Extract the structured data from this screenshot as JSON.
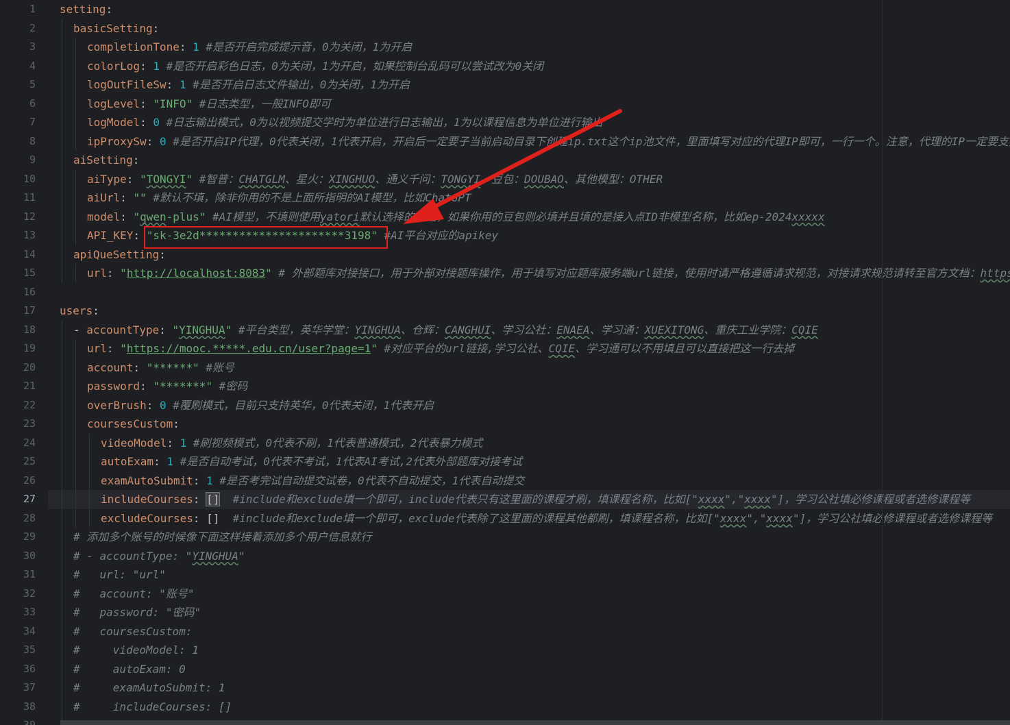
{
  "editor": {
    "current_line": 27,
    "lines": [
      {
        "n": "1",
        "indent": 0,
        "tokens": [
          {
            "t": "setting",
            "c": "k0"
          },
          {
            "t": ": ",
            "c": "k-plain"
          }
        ]
      },
      {
        "n": "2",
        "indent": 1,
        "tokens": [
          {
            "t": "basicSetting",
            "c": "k0"
          },
          {
            "t": ":",
            "c": "k-plain"
          }
        ]
      },
      {
        "n": "3",
        "indent": 2,
        "tokens": [
          {
            "t": "completionTone",
            "c": "k0"
          },
          {
            "t": ": ",
            "c": "k-plain"
          },
          {
            "t": "1 ",
            "c": "k-num"
          },
          {
            "t": "#是否开启完成提示音，0为关闭，1为开启",
            "c": "k-cmt"
          }
        ]
      },
      {
        "n": "4",
        "indent": 2,
        "tokens": [
          {
            "t": "colorLog",
            "c": "k0"
          },
          {
            "t": ": ",
            "c": "k-plain"
          },
          {
            "t": "1 ",
            "c": "k-num"
          },
          {
            "t": "#是否开启彩色日志，0为关闭，1为开启，如果控制台乱码可以尝试改为0关闭",
            "c": "k-cmt"
          }
        ]
      },
      {
        "n": "5",
        "indent": 2,
        "tokens": [
          {
            "t": "logOutFileSw",
            "c": "k0"
          },
          {
            "t": ": ",
            "c": "k-plain"
          },
          {
            "t": "1 ",
            "c": "k-num"
          },
          {
            "t": "#是否开启日志文件输出，0为关闭，1为开启",
            "c": "k-cmt"
          }
        ]
      },
      {
        "n": "6",
        "indent": 2,
        "tokens": [
          {
            "t": "logLevel",
            "c": "k0"
          },
          {
            "t": ": ",
            "c": "k-plain"
          },
          {
            "t": "\"INFO\" ",
            "c": "k-str"
          },
          {
            "t": "#日志类型，一般INFO即可",
            "c": "k-cmt"
          }
        ]
      },
      {
        "n": "7",
        "indent": 2,
        "tokens": [
          {
            "t": "logModel",
            "c": "k0"
          },
          {
            "t": ": ",
            "c": "k-plain"
          },
          {
            "t": "0 ",
            "c": "k-num"
          },
          {
            "t": "#日志输出模式，0为以视频提交学时为单位进行日志输出，1为以课程信息为单位进行输出",
            "c": "k-cmt"
          }
        ]
      },
      {
        "n": "8",
        "indent": 2,
        "tokens": [
          {
            "t": "ipProxySw",
            "c": "k0"
          },
          {
            "t": ": ",
            "c": "k-plain"
          },
          {
            "t": "0 ",
            "c": "k-num"
          },
          {
            "t": "#是否开启IP代理，0代表关闭，1代表开启，开启后一定要子当前启动目录下创建ip.txt这个ip池文件，里面填写对应的代理IP即可，一行一个。注意，代理的IP一定要支持",
            "c": "k-cmt"
          }
        ]
      },
      {
        "n": "9",
        "indent": 1,
        "tokens": [
          {
            "t": "aiSetting",
            "c": "k0"
          },
          {
            "t": ":",
            "c": "k-plain"
          }
        ]
      },
      {
        "n": "10",
        "indent": 2,
        "tokens": [
          {
            "t": "aiType",
            "c": "k0"
          },
          {
            "t": ": ",
            "c": "k-plain"
          },
          {
            "t": "\"",
            "c": "k-str"
          },
          {
            "t": "TONGYI",
            "c": "k-str",
            "w": 1
          },
          {
            "t": "\" ",
            "c": "k-str"
          },
          {
            "t": "#智普：",
            "c": "k-cmt"
          },
          {
            "t": "CHATGLM",
            "c": "k-cmt",
            "w": 1
          },
          {
            "t": "、星火：",
            "c": "k-cmt"
          },
          {
            "t": "XINGHUO",
            "c": "k-cmt",
            "w": 1
          },
          {
            "t": "、通义千问：",
            "c": "k-cmt"
          },
          {
            "t": "TONGYI",
            "c": "k-cmt",
            "w": 1
          },
          {
            "t": "、豆包：",
            "c": "k-cmt"
          },
          {
            "t": "DOUBAO",
            "c": "k-cmt",
            "w": 1
          },
          {
            "t": "、其他模型：OTHER",
            "c": "k-cmt"
          }
        ]
      },
      {
        "n": "11",
        "indent": 2,
        "tokens": [
          {
            "t": "aiUrl",
            "c": "k0"
          },
          {
            "t": ": ",
            "c": "k-plain"
          },
          {
            "t": "\"\" ",
            "c": "k-str"
          },
          {
            "t": "#默认不填，除非你用的不是上面所指明的AI模型，比如ChatGPT",
            "c": "k-cmt"
          }
        ]
      },
      {
        "n": "12",
        "indent": 2,
        "tokens": [
          {
            "t": "model",
            "c": "k0"
          },
          {
            "t": ": ",
            "c": "k-plain"
          },
          {
            "t": "\"",
            "c": "k-str"
          },
          {
            "t": "qwen",
            "c": "k-str",
            "w": 1
          },
          {
            "t": "-plus\" ",
            "c": "k-str"
          },
          {
            "t": "#AI模型，不填则使用",
            "c": "k-cmt"
          },
          {
            "t": "yatori",
            "c": "k-cmt",
            "w": 1
          },
          {
            "t": "默认选择的模型，如果你用的豆包则必填并且填的是接入点ID非模型名称，比如ep-2024",
            "c": "k-cmt"
          },
          {
            "t": "xxxxx",
            "c": "k-cmt",
            "w": 1
          }
        ]
      },
      {
        "n": "13",
        "indent": 2,
        "tokens": [
          {
            "t": "API_KEY",
            "c": "k0"
          },
          {
            "t": ": ",
            "c": "k-plain"
          },
          {
            "t": "\"sk-3e2d**********************3198\" ",
            "c": "k-str"
          },
          {
            "t": "#AI平台对应的apikey",
            "c": "k-cmt"
          }
        ]
      },
      {
        "n": "14",
        "indent": 1,
        "tokens": [
          {
            "t": "apiQueSetting",
            "c": "k0"
          },
          {
            "t": ":",
            "c": "k-plain"
          }
        ]
      },
      {
        "n": "15",
        "indent": 2,
        "tokens": [
          {
            "t": "url",
            "c": "k0"
          },
          {
            "t": ": ",
            "c": "k-plain"
          },
          {
            "t": "\"",
            "c": "k-str"
          },
          {
            "t": "http://localhost:8083",
            "c": "k-link"
          },
          {
            "t": "\" ",
            "c": "k-str"
          },
          {
            "t": "# 外部题库对接接口，用于外部对接题库操作，用于填写对应题库服务端url链接，使用时请严格遵循请求规范，对接请求规范请转至官方文档：",
            "c": "k-cmt"
          },
          {
            "t": "https://",
            "c": "k-cmt",
            "w": 1
          }
        ]
      },
      {
        "n": "16",
        "indent": 0,
        "tokens": []
      },
      {
        "n": "17",
        "indent": 0,
        "tokens": [
          {
            "t": "users",
            "c": "k0"
          },
          {
            "t": ":",
            "c": "k-plain"
          }
        ]
      },
      {
        "n": "18",
        "indent": 1,
        "tokens": [
          {
            "t": "- ",
            "c": "k-plain"
          },
          {
            "t": "accountType",
            "c": "k0"
          },
          {
            "t": ": ",
            "c": "k-plain"
          },
          {
            "t": "\"",
            "c": "k-str"
          },
          {
            "t": "YINGHUA",
            "c": "k-str",
            "w": 1
          },
          {
            "t": "\" ",
            "c": "k-str"
          },
          {
            "t": "#平台类型，英华学堂：",
            "c": "k-cmt"
          },
          {
            "t": "YINGHUA",
            "c": "k-cmt",
            "w": 1
          },
          {
            "t": "、仓辉：",
            "c": "k-cmt"
          },
          {
            "t": "CANGHUI",
            "c": "k-cmt",
            "w": 1
          },
          {
            "t": "、学习公社：",
            "c": "k-cmt"
          },
          {
            "t": "ENAEA",
            "c": "k-cmt",
            "w": 1
          },
          {
            "t": "、学习通：",
            "c": "k-cmt"
          },
          {
            "t": "XUEXITONG",
            "c": "k-cmt",
            "w": 1
          },
          {
            "t": "、重庆工业学院：",
            "c": "k-cmt"
          },
          {
            "t": "CQIE",
            "c": "k-cmt",
            "w": 1
          }
        ]
      },
      {
        "n": "19",
        "indent": 2,
        "tokens": [
          {
            "t": "url",
            "c": "k0"
          },
          {
            "t": ": ",
            "c": "k-plain"
          },
          {
            "t": "\"",
            "c": "k-str"
          },
          {
            "t": "https://mooc.*****.edu.cn/user?page=1",
            "c": "k-link"
          },
          {
            "t": "\" ",
            "c": "k-str"
          },
          {
            "t": "#对应平台的url链接,学习公社、",
            "c": "k-cmt"
          },
          {
            "t": "CQIE",
            "c": "k-cmt",
            "w": 1
          },
          {
            "t": "、学习通可以不用填且可以直接把这一行去掉",
            "c": "k-cmt"
          }
        ]
      },
      {
        "n": "20",
        "indent": 2,
        "tokens": [
          {
            "t": "account",
            "c": "k0"
          },
          {
            "t": ": ",
            "c": "k-plain"
          },
          {
            "t": "\"******\" ",
            "c": "k-str"
          },
          {
            "t": "#账号",
            "c": "k-cmt"
          }
        ]
      },
      {
        "n": "21",
        "indent": 2,
        "tokens": [
          {
            "t": "password",
            "c": "k0"
          },
          {
            "t": ": ",
            "c": "k-plain"
          },
          {
            "t": "\"*******\" ",
            "c": "k-str"
          },
          {
            "t": "#密码",
            "c": "k-cmt"
          }
        ]
      },
      {
        "n": "22",
        "indent": 2,
        "tokens": [
          {
            "t": "overBrush",
            "c": "k0"
          },
          {
            "t": ": ",
            "c": "k-plain"
          },
          {
            "t": "0 ",
            "c": "k-num"
          },
          {
            "t": "#覆刷模式，目前只支持英华，0代表关闭，1代表开启",
            "c": "k-cmt"
          }
        ]
      },
      {
        "n": "23",
        "indent": 2,
        "tokens": [
          {
            "t": "coursesCustom",
            "c": "k0"
          },
          {
            "t": ":",
            "c": "k-plain"
          }
        ]
      },
      {
        "n": "24",
        "indent": 3,
        "tokens": [
          {
            "t": "videoModel",
            "c": "k0"
          },
          {
            "t": ": ",
            "c": "k-plain"
          },
          {
            "t": "1 ",
            "c": "k-num"
          },
          {
            "t": "#刷视频模式，0代表不刷，1代表普通模式，2代表暴力模式",
            "c": "k-cmt"
          }
        ]
      },
      {
        "n": "25",
        "indent": 3,
        "tokens": [
          {
            "t": "autoExam",
            "c": "k0"
          },
          {
            "t": ": ",
            "c": "k-plain"
          },
          {
            "t": "1 ",
            "c": "k-num"
          },
          {
            "t": "#是否自动考试，0代表不考试，1代表AI考试,2代表外部题库对接考试",
            "c": "k-cmt"
          }
        ]
      },
      {
        "n": "26",
        "indent": 3,
        "tokens": [
          {
            "t": "examAutoSubmit",
            "c": "k0"
          },
          {
            "t": ": ",
            "c": "k-plain"
          },
          {
            "t": "1 ",
            "c": "k-num"
          },
          {
            "t": "#是否考完试自动提交试卷，0代表不自动提交，1代表自动提交",
            "c": "k-cmt"
          }
        ]
      },
      {
        "n": "27",
        "indent": 3,
        "tokens": [
          {
            "t": "includeCourses",
            "c": "k0"
          },
          {
            "t": ": ",
            "c": "k-plain"
          },
          {
            "t": "[]",
            "c": "k-bracket",
            "hl": 1
          },
          {
            "t": "  ",
            "c": "k-plain"
          },
          {
            "t": "#include和exclude填一个即可，include代表只有这里面的课程才刷，填课程名称，比如[\"",
            "c": "k-cmt"
          },
          {
            "t": "xxxx",
            "c": "k-cmt",
            "w": 1
          },
          {
            "t": "\",\"",
            "c": "k-cmt"
          },
          {
            "t": "xxxx",
            "c": "k-cmt",
            "w": 1
          },
          {
            "t": "\"]，学习公社填必修课程或者选修课程等",
            "c": "k-cmt"
          }
        ]
      },
      {
        "n": "28",
        "indent": 3,
        "tokens": [
          {
            "t": "excludeCourses",
            "c": "k0"
          },
          {
            "t": ": ",
            "c": "k-plain"
          },
          {
            "t": "[]",
            "c": "k-bracket"
          },
          {
            "t": "  ",
            "c": "k-plain"
          },
          {
            "t": "#include和exclude填一个即可，exclude代表除了这里面的课程其他都刷，填课程名称，比如[\"",
            "c": "k-cmt"
          },
          {
            "t": "xxxx",
            "c": "k-cmt",
            "w": 1
          },
          {
            "t": "\",\"",
            "c": "k-cmt"
          },
          {
            "t": "xxxx",
            "c": "k-cmt",
            "w": 1
          },
          {
            "t": "\"]，学习公社填必修课程或者选修课程等",
            "c": "k-cmt"
          }
        ]
      },
      {
        "n": "29",
        "indent": 1,
        "tokens": [
          {
            "t": "# 添加多个账号的时候像下面这样接着添加多个用户信息就行",
            "c": "k-cmt"
          }
        ]
      },
      {
        "n": "30",
        "indent": 1,
        "tokens": [
          {
            "t": "# - accountType: \"",
            "c": "k-cmt"
          },
          {
            "t": "YINGHUA",
            "c": "k-cmt",
            "w": 1
          },
          {
            "t": "\"",
            "c": "k-cmt"
          }
        ]
      },
      {
        "n": "31",
        "indent": 1,
        "tokens": [
          {
            "t": "#   url: \"url\"",
            "c": "k-cmt"
          }
        ]
      },
      {
        "n": "32",
        "indent": 1,
        "tokens": [
          {
            "t": "#   account: \"账号\"",
            "c": "k-cmt"
          }
        ]
      },
      {
        "n": "33",
        "indent": 1,
        "tokens": [
          {
            "t": "#   password: \"密码\"",
            "c": "k-cmt"
          }
        ]
      },
      {
        "n": "34",
        "indent": 1,
        "tokens": [
          {
            "t": "#   coursesCustom:",
            "c": "k-cmt"
          }
        ]
      },
      {
        "n": "35",
        "indent": 1,
        "tokens": [
          {
            "t": "#     videoModel: 1",
            "c": "k-cmt"
          }
        ]
      },
      {
        "n": "36",
        "indent": 1,
        "tokens": [
          {
            "t": "#     autoExam: 0",
            "c": "k-cmt"
          }
        ]
      },
      {
        "n": "37",
        "indent": 1,
        "tokens": [
          {
            "t": "#     examAutoSubmit: 1",
            "c": "k-cmt"
          }
        ]
      },
      {
        "n": "38",
        "indent": 1,
        "tokens": [
          {
            "t": "#     includeCourses: []",
            "c": "k-cmt"
          }
        ]
      },
      {
        "n": "39",
        "indent": 1,
        "tokens": [
          {
            "t": "#     excludeCourses: []",
            "c": "k-cmt"
          }
        ]
      }
    ]
  },
  "annotation": {
    "highlight_color": "#e0201b",
    "target": "API_KEY value"
  }
}
